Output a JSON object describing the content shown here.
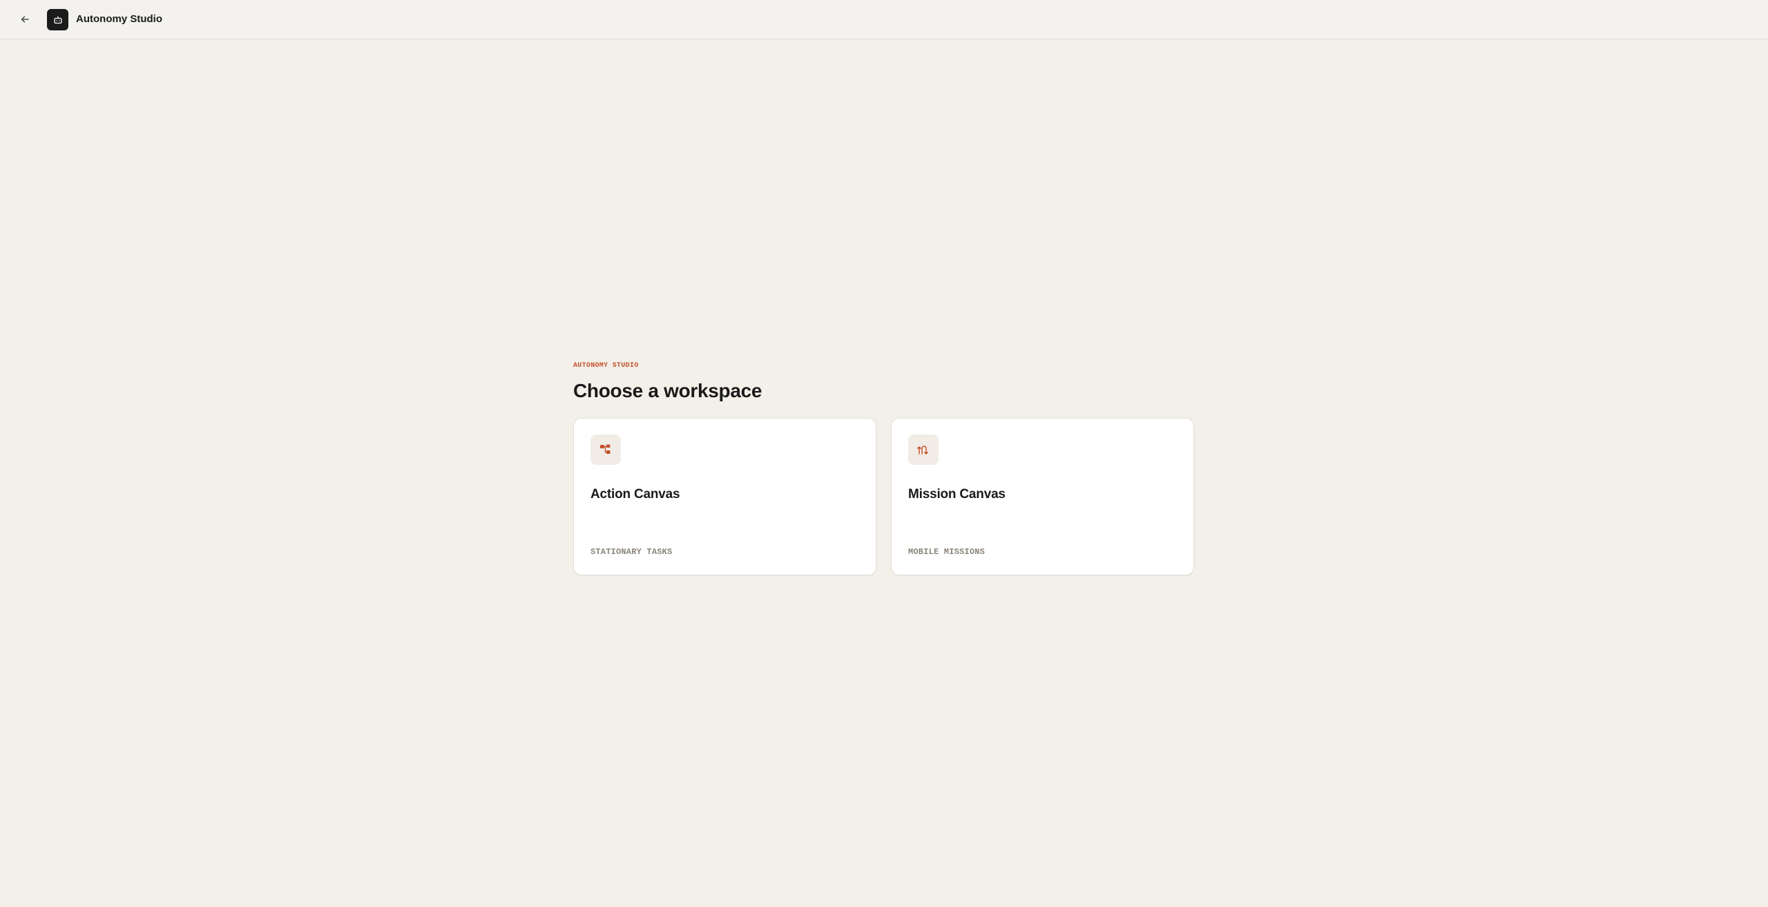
{
  "header": {
    "back_icon": "arrow-left-icon",
    "logo_icon": "robot-icon",
    "app_title": "Autonomy Studio"
  },
  "main": {
    "eyebrow": "AUTONOMY STUDIO",
    "heading": "Choose a workspace",
    "cards": [
      {
        "title": "Action Canvas",
        "tag": "STATIONARY TASKS",
        "icon": "workflow-icon"
      },
      {
        "title": "Mission Canvas",
        "tag": "MOBILE MISSIONS",
        "icon": "route-icon"
      }
    ]
  },
  "colors": {
    "background": "#f3f0e9",
    "accent": "#c4502c",
    "card_background": "#ffffff",
    "muted_text": "#8a847a"
  }
}
